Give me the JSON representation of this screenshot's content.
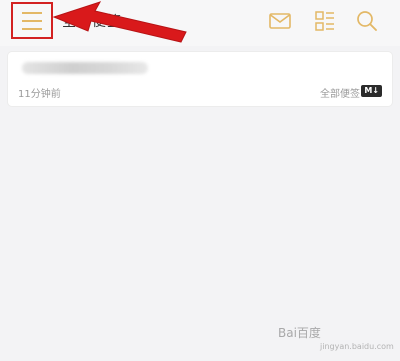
{
  "header": {
    "title": "全部便签",
    "menu_icon": "hamburger-menu-icon",
    "icons": [
      "mail-icon",
      "layout-grid-icon",
      "search-icon"
    ],
    "accent_color": "#e3b866",
    "highlight_color": "#d32121"
  },
  "note": {
    "time": "11分钟前",
    "category": "全部便签",
    "badge": "M↓"
  },
  "watermark": {
    "logo_text": "Bai百度",
    "sub_text": "jingyan.baidu.com"
  }
}
